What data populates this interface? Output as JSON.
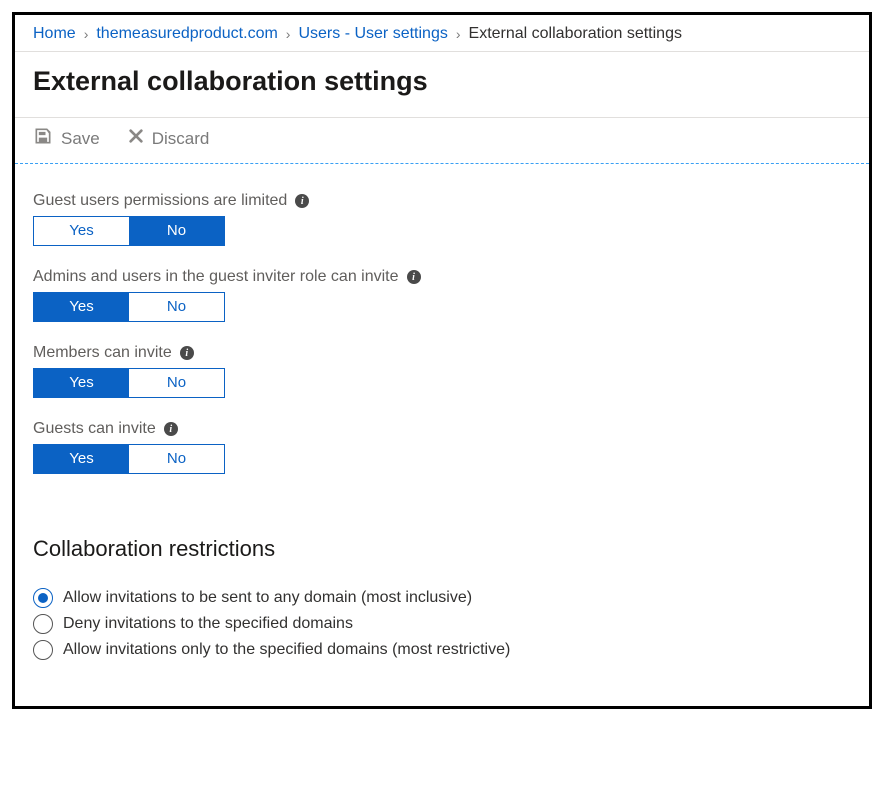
{
  "breadcrumb": {
    "items": [
      {
        "label": "Home",
        "link": true
      },
      {
        "label": "themeasuredproduct.com",
        "link": true
      },
      {
        "label": "Users - User settings",
        "link": true
      },
      {
        "label": "External collaboration settings",
        "link": false
      }
    ]
  },
  "page": {
    "title": "External collaboration settings"
  },
  "toolbar": {
    "save_label": "Save",
    "discard_label": "Discard"
  },
  "toggles": {
    "yes": "Yes",
    "no": "No",
    "items": [
      {
        "label": "Guest users permissions are limited",
        "value": "No"
      },
      {
        "label": "Admins and users in the guest inviter role can invite",
        "value": "Yes"
      },
      {
        "label": "Members can invite",
        "value": "Yes"
      },
      {
        "label": "Guests can invite",
        "value": "Yes"
      }
    ]
  },
  "collab": {
    "heading": "Collaboration restrictions",
    "options": [
      {
        "label": "Allow invitations to be sent to any domain (most inclusive)",
        "selected": true
      },
      {
        "label": "Deny invitations to the specified domains",
        "selected": false
      },
      {
        "label": "Allow invitations only to the specified domains (most restrictive)",
        "selected": false
      }
    ]
  }
}
